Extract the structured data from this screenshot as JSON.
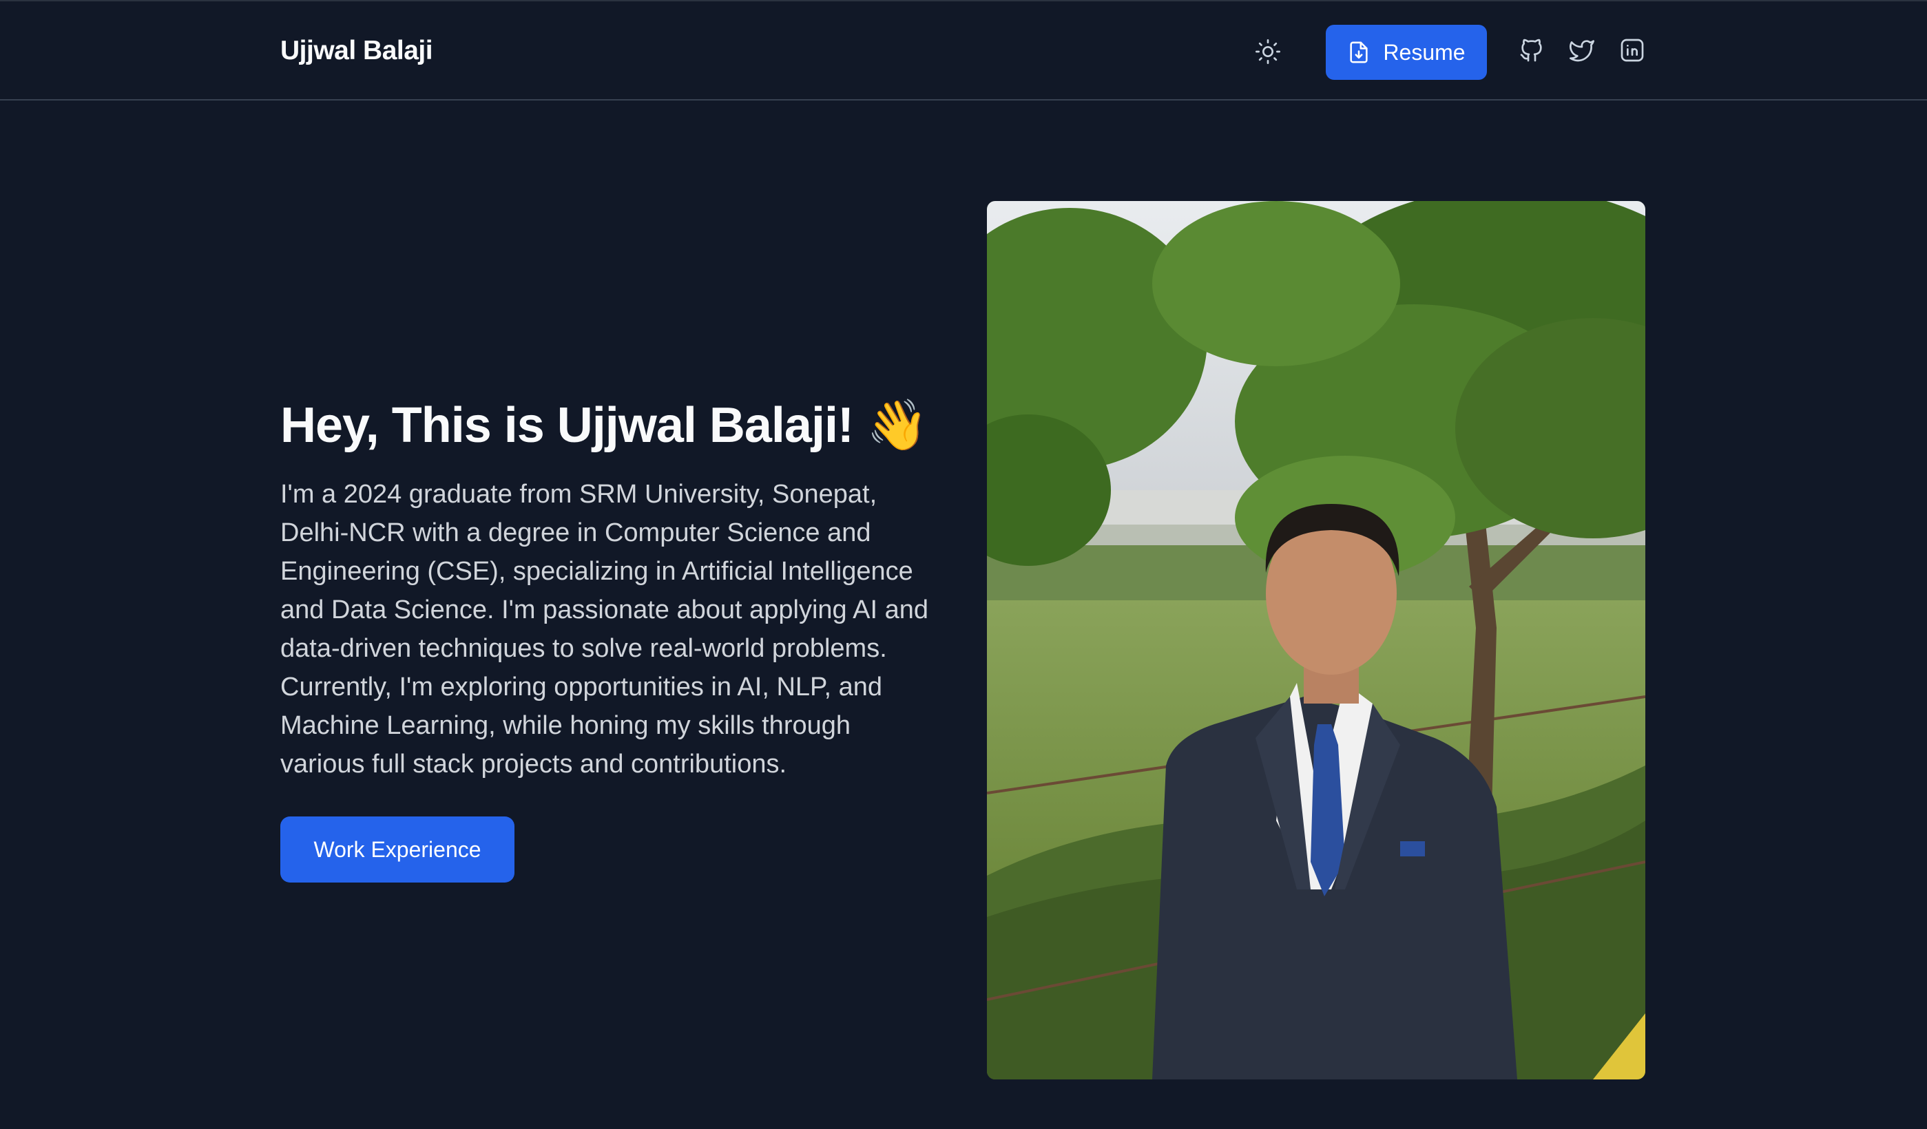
{
  "header": {
    "brand": "Ujjwal Balaji",
    "theme_toggle_icon": "sun-icon",
    "resume_label": "Resume",
    "resume_icon": "file-download-icon",
    "social": [
      {
        "name": "github",
        "icon": "github-icon"
      },
      {
        "name": "twitter",
        "icon": "twitter-icon"
      },
      {
        "name": "linkedin",
        "icon": "linkedin-icon"
      }
    ]
  },
  "hero": {
    "title": "Hey, This is Ujjwal Balaji!",
    "title_emoji": "👋",
    "description": "I'm a 2024 graduate from SRM University, Sonepat, Delhi-NCR with a degree in Computer Science and Engineering (CSE), specializing in Artificial Intelligence and Data Science. I'm passionate about applying AI and data-driven techniques to solve real-world problems. Currently, I'm exploring opportunities in AI, NLP, and Machine Learning, while honing my skills through various full stack projects and contributions.",
    "cta_label": "Work Experience"
  },
  "colors": {
    "background": "#111827",
    "accent": "#2563eb",
    "text_primary": "#f9fafb",
    "text_secondary": "#d1d5db",
    "border": "#374151"
  }
}
